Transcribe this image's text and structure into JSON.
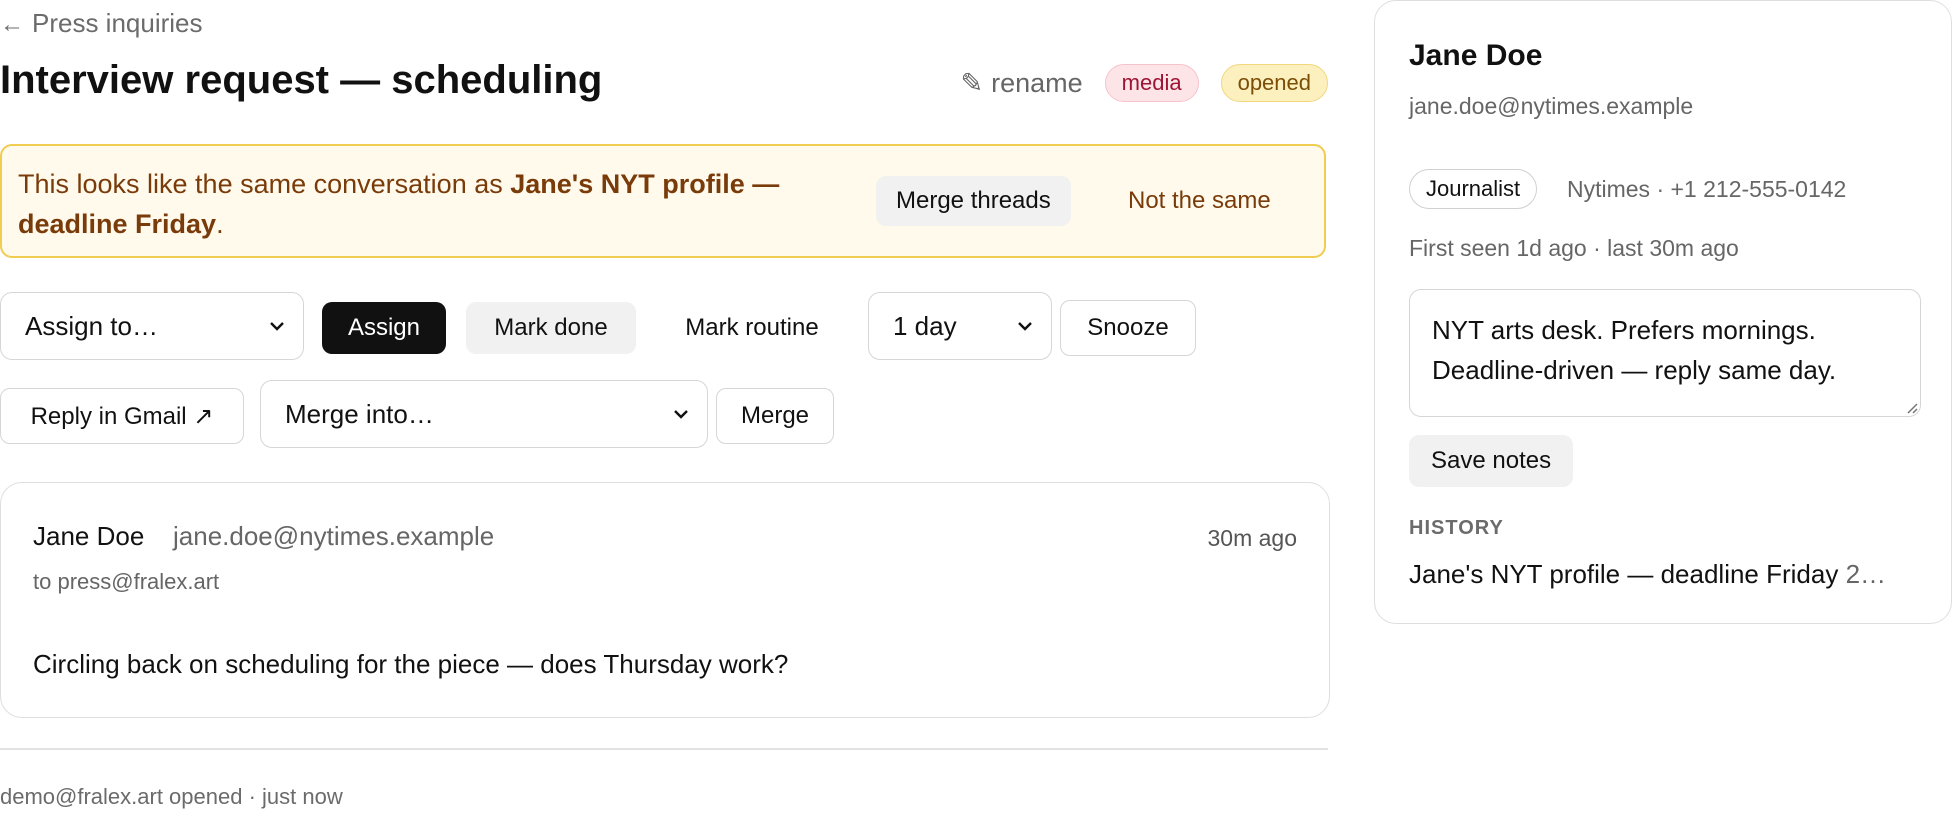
{
  "nav": {
    "back_label": "Press inquiries"
  },
  "thread": {
    "title": "Interview request — scheduling",
    "rename_label": "rename",
    "tags": [
      "media",
      "opened"
    ]
  },
  "banner": {
    "text_prefix": "This looks like the same conversation as ",
    "linked_thread": "Jane's NYT profile — deadline Friday",
    "text_suffix": ".",
    "merge_threads_label": "Merge threads",
    "not_same_label": "Not the same"
  },
  "actions": {
    "assign_select_value": "Assign to…",
    "assign_label": "Assign",
    "mark_done_label": "Mark done",
    "mark_routine_label": "Mark routine",
    "snooze_select_value": "1 day",
    "snooze_label": "Snooze",
    "reply_gmail_label": "Reply in Gmail ↗",
    "merge_select_value": "Merge into…",
    "merge_label": "Merge"
  },
  "message": {
    "from_name": "Jane Doe",
    "from_email": "jane.doe@nytimes.example",
    "time": "30m ago",
    "to": "to press@fralex.art",
    "body": "Circling back on scheduling for the piece — does Thursday work?"
  },
  "footer": {
    "activity": "demo@fralex.art opened · just now"
  },
  "contact": {
    "name": "Jane Doe",
    "email": "jane.doe@nytimes.example",
    "role": "Journalist",
    "org_phone": "Nytimes · +1 212-555-0142",
    "seen": "First seen 1d ago · last 30m ago",
    "notes_line1": "NYT arts desk. Prefers mornings.",
    "notes_line2": "Deadline-driven — reply same day.",
    "save_notes_label": "Save notes",
    "history_label": "HISTORY",
    "history_title": "Jane's NYT profile — deadline Friday",
    "history_meta": "2…"
  },
  "colors": {
    "banner_bg": "#fffaeb",
    "banner_border": "#f0cc50",
    "banner_text": "#7a3b0a",
    "tag_media_bg": "#fde4e7",
    "tag_media_text": "#9c1535",
    "tag_opened_bg": "#fdf0bf",
    "tag_opened_text": "#7a4e06",
    "primary_button": "#111111"
  },
  "icons": {
    "back": "left-arrow-icon",
    "rename": "pencil-icon",
    "select": "chevron-down-icon"
  }
}
